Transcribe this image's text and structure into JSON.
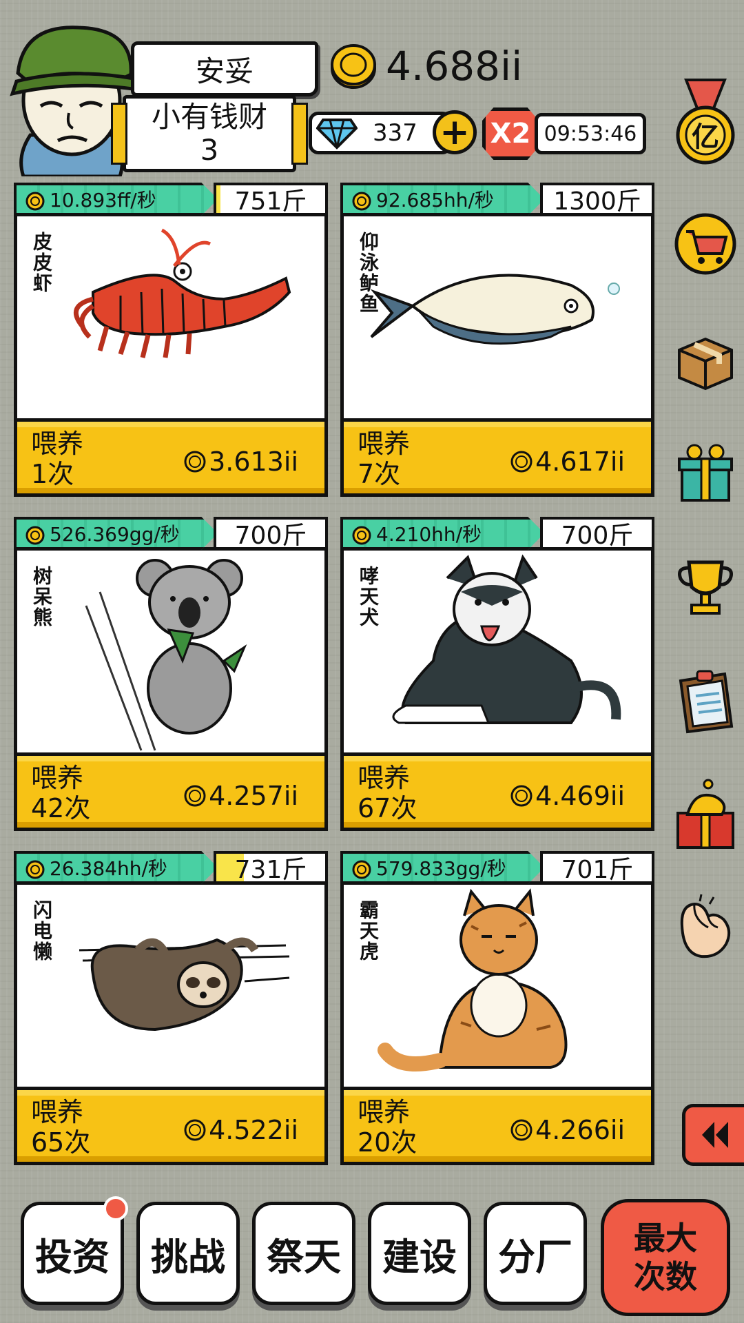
{
  "player": {
    "name": "安妥",
    "rank": "小有钱财",
    "level": "3"
  },
  "currency": {
    "coins": "4.688ii",
    "gems": "337",
    "multiplier": "X2",
    "timer": "09:53:46"
  },
  "animals": [
    {
      "name": "皮皮虾",
      "rate": "10.893ff/秒",
      "weight": "751斤",
      "weight_fill_pct": 4,
      "feed_label": "喂养",
      "feed_count": "1次",
      "cost": "3.613ii",
      "icon": "shrimp"
    },
    {
      "name": "仰泳鲈鱼",
      "rate": "92.685hh/秒",
      "weight": "1300斤",
      "weight_fill_pct": 0,
      "feed_label": "喂养",
      "feed_count": "7次",
      "cost": "4.617ii",
      "icon": "fish"
    },
    {
      "name": "树呆熊",
      "rate": "526.369gg/秒",
      "weight": "700斤",
      "weight_fill_pct": 0,
      "feed_label": "喂养",
      "feed_count": "42次",
      "cost": "4.257ii",
      "icon": "koala"
    },
    {
      "name": "哮天犬",
      "rate": "4.210hh/秒",
      "weight": "700斤",
      "weight_fill_pct": 0,
      "feed_label": "喂养",
      "feed_count": "67次",
      "cost": "4.469ii",
      "icon": "husky"
    },
    {
      "name": "闪电懒",
      "rate": "26.384hh/秒",
      "weight": "731斤",
      "weight_fill_pct": 25,
      "feed_label": "喂养",
      "feed_count": "65次",
      "cost": "4.522ii",
      "icon": "sloth"
    },
    {
      "name": "霸天虎",
      "rate": "579.833gg/秒",
      "weight": "701斤",
      "weight_fill_pct": 0,
      "feed_label": "喂养",
      "feed_count": "20次",
      "cost": "4.266ii",
      "icon": "cat"
    }
  ],
  "sidebar": {
    "billion_medal": "亿",
    "icons": [
      "medal-icon",
      "shopping-cart-icon",
      "package-icon",
      "gift-box-icon",
      "trophy-icon",
      "clipboard-icon",
      "mystery-gift-icon",
      "hand-gesture-icon",
      "collapse-icon"
    ]
  },
  "nav": {
    "invest": "投资",
    "challenge": "挑战",
    "worship": "祭天",
    "build": "建设",
    "branch": "分厂",
    "max_line1": "最大",
    "max_line2": "次数"
  },
  "colors": {
    "accent_yellow": "#f7c215",
    "accent_green": "#49d0a3",
    "accent_red": "#ef5a45"
  }
}
